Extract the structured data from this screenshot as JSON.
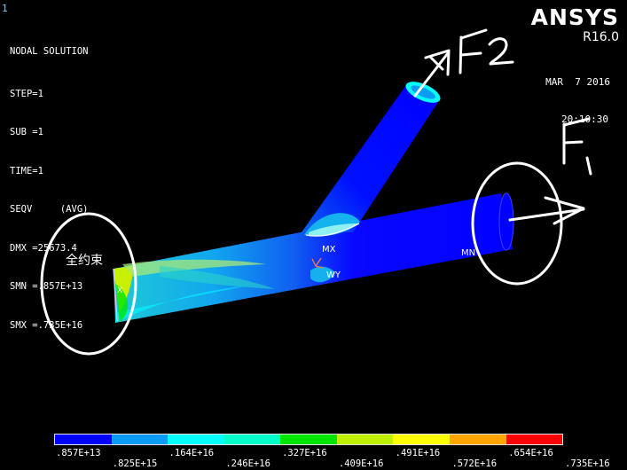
{
  "window": {
    "number": "1"
  },
  "solution": {
    "title": "NODAL SOLUTION",
    "lines": [
      "STEP=1",
      "SUB =1",
      "TIME=1",
      "SEQV     (AVG)",
      "DMX =25673.4",
      "SMN =.857E+13",
      "SMX =.735E+16"
    ]
  },
  "brand": {
    "name": "ANSYS",
    "version": "R16.0"
  },
  "timestamp": {
    "date": "MAR  7 2016",
    "time": "20:10:30"
  },
  "annotations": {
    "fixed_support": "全约束",
    "force1": "F1",
    "force2": "F2"
  },
  "node_labels": {
    "mn": "MN",
    "mx": "MX",
    "wy": "WY"
  },
  "legend": {
    "colors": [
      "#0000ff",
      "#0a9cf5",
      "#00ffff",
      "#00ffc8",
      "#00e600",
      "#bef000",
      "#ffff00",
      "#ffa500",
      "#ff0000"
    ],
    "ticks_top": [
      ".857E+13",
      ".164E+16",
      ".327E+16",
      ".491E+16",
      ".654E+16"
    ],
    "ticks_bottom": [
      ".825E+15",
      ".246E+16",
      ".409E+16",
      ".572E+16",
      ".735E+16"
    ]
  }
}
